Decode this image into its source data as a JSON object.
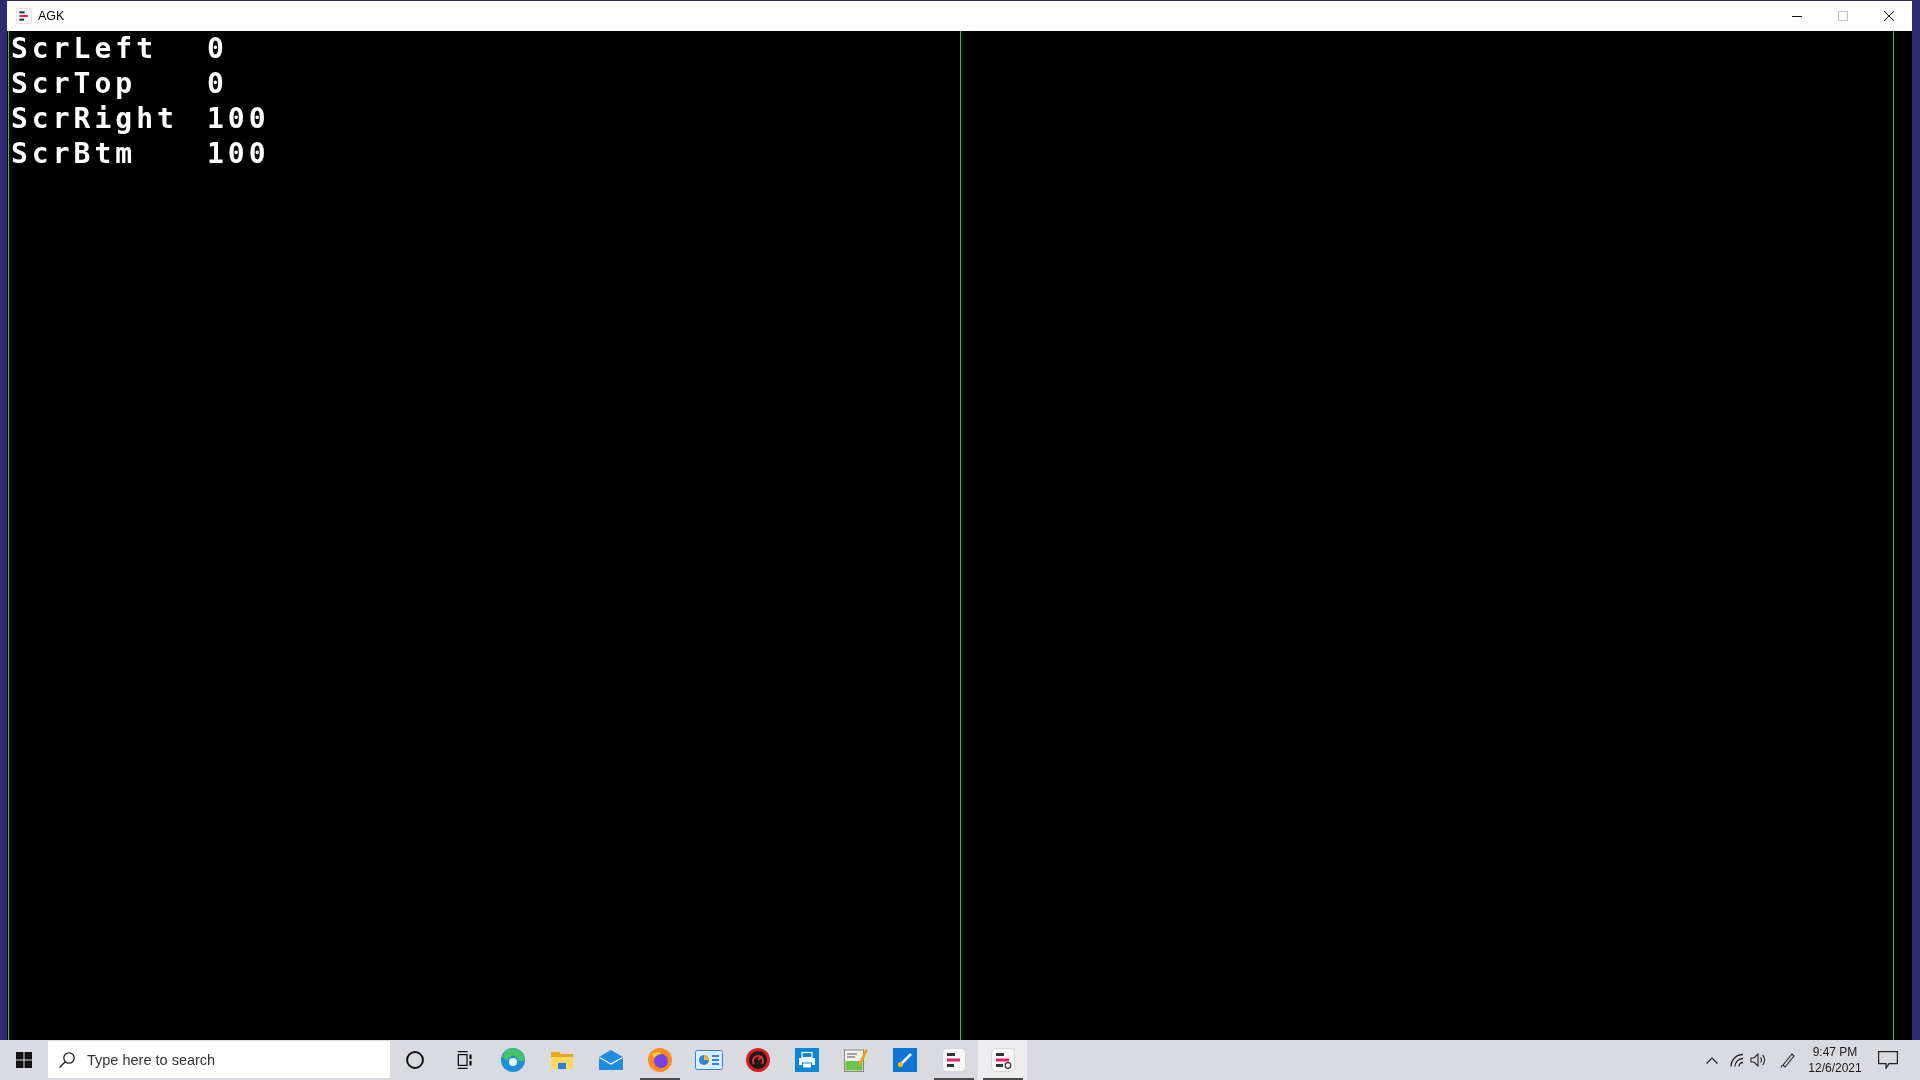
{
  "window": {
    "title": "AGK",
    "controls": [
      {
        "kind": "minimize",
        "disabled": false
      },
      {
        "kind": "maximize",
        "disabled": true
      },
      {
        "kind": "close",
        "disabled": false
      }
    ]
  },
  "readouts": [
    {
      "label": "ScrLeft",
      "value": "0"
    },
    {
      "label": "ScrTop",
      "value": "0"
    },
    {
      "label": "ScrRight",
      "value": "100"
    },
    {
      "label": "ScrBtm",
      "value": "100"
    }
  ],
  "taskbar": {
    "search": {
      "placeholder": "Type here to search"
    },
    "items": [
      {
        "kind": "ring",
        "running": false,
        "selected": false
      },
      {
        "kind": "panes",
        "running": false,
        "selected": false
      },
      {
        "kind": "swirl",
        "running": false,
        "selected": false
      },
      {
        "kind": "folder",
        "running": false,
        "selected": false
      },
      {
        "kind": "envelope",
        "running": false,
        "selected": false
      },
      {
        "kind": "fox",
        "running": true,
        "selected": false
      },
      {
        "kind": "dashboard",
        "running": false,
        "selected": false
      },
      {
        "kind": "dial",
        "running": false,
        "selected": false
      },
      {
        "kind": "printer",
        "running": false,
        "selected": false
      },
      {
        "kind": "notepad",
        "running": false,
        "selected": false
      },
      {
        "kind": "brush",
        "running": false,
        "selected": false
      },
      {
        "kind": "logo",
        "running": true,
        "selected": false
      },
      {
        "kind": "logoplay",
        "running": true,
        "selected": true
      }
    ],
    "clock": {
      "time": "9:47 PM",
      "date": "12/6/2021"
    }
  }
}
